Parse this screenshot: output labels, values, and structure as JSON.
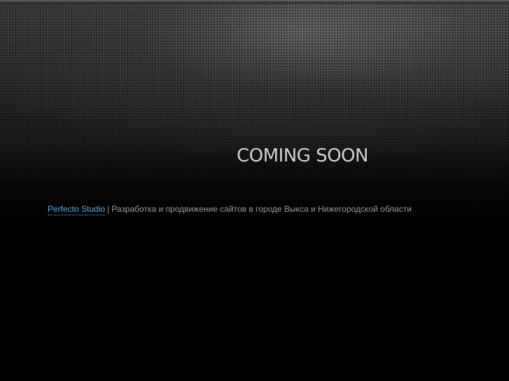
{
  "hero": {
    "headline": "COMING SOON"
  },
  "footer": {
    "brand_link": "Perfecto Studio",
    "separator": "|",
    "description": "Разработка и продвижение сайтов в городе Выкса и Нижегородской области"
  },
  "colors": {
    "background": "#000000",
    "headline": "#d4d4d4",
    "link": "#5fa9e6",
    "text": "#9a9a9a"
  }
}
